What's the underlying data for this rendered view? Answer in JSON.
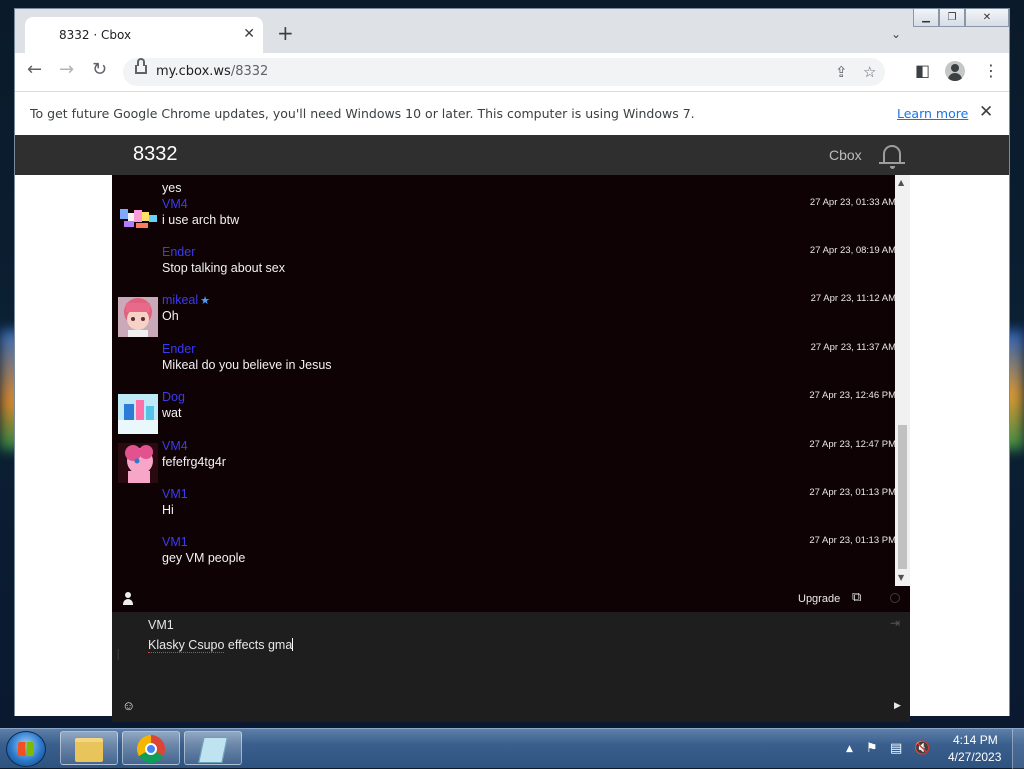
{
  "browser": {
    "tab_title": "8332 · Cbox",
    "url_host": "my.cbox.ws",
    "url_path": "/8332",
    "infobar_text": "To get future Google Chrome updates, you'll need Windows 10 or later. This computer is using Windows 7.",
    "infobar_link": "Learn more"
  },
  "cbox": {
    "title": "8332",
    "brand": "Cbox",
    "messages": [
      {
        "name": "",
        "text": "yes",
        "time": "",
        "avatar": "none"
      },
      {
        "name": "VM4",
        "text": "i use arch btw",
        "time": "27 Apr 23, 01:33 AM",
        "avatar": "colorful-collage"
      },
      {
        "name": "Ender",
        "text": "Stop talking about sex",
        "time": "27 Apr 23, 08:19 AM",
        "avatar": "none"
      },
      {
        "name": "mikeal",
        "text": "Oh",
        "time": "27 Apr 23, 11:12 AM",
        "avatar": "pink-anime",
        "star": true
      },
      {
        "name": "Ender",
        "text": "Mikeal do you believe in Jesus",
        "time": "27 Apr 23, 11:37 AM",
        "avatar": "none"
      },
      {
        "name": "Dog",
        "text": "wat",
        "time": "27 Apr 23, 12:46 PM",
        "avatar": "blue-cartoon"
      },
      {
        "name": "VM4",
        "text": "fefefrg4tg4r",
        "time": "27 Apr 23, 12:47 PM",
        "avatar": "pink-pony"
      },
      {
        "name": "VM1",
        "text": "Hi",
        "time": "27 Apr 23, 01:13 PM",
        "avatar": "none"
      },
      {
        "name": "VM1",
        "text": "gey VM people",
        "time": "27 Apr 23, 01:13 PM",
        "avatar": "none"
      }
    ],
    "footer": {
      "upgrade_label": "Upgrade",
      "compose_name": "VM1",
      "compose_text_misspelled": "Klasky Csupo",
      "compose_text_rest": " effects gma"
    },
    "colors": {
      "header_bg": "#2f2f2f",
      "chat_bg": "#0f0205",
      "name_color": "#3a3af5"
    }
  },
  "taskbar": {
    "time": "4:14 PM",
    "date": "4/27/2023",
    "items": [
      "explorer-icon",
      "chrome-icon",
      "notepad-icon"
    ]
  }
}
